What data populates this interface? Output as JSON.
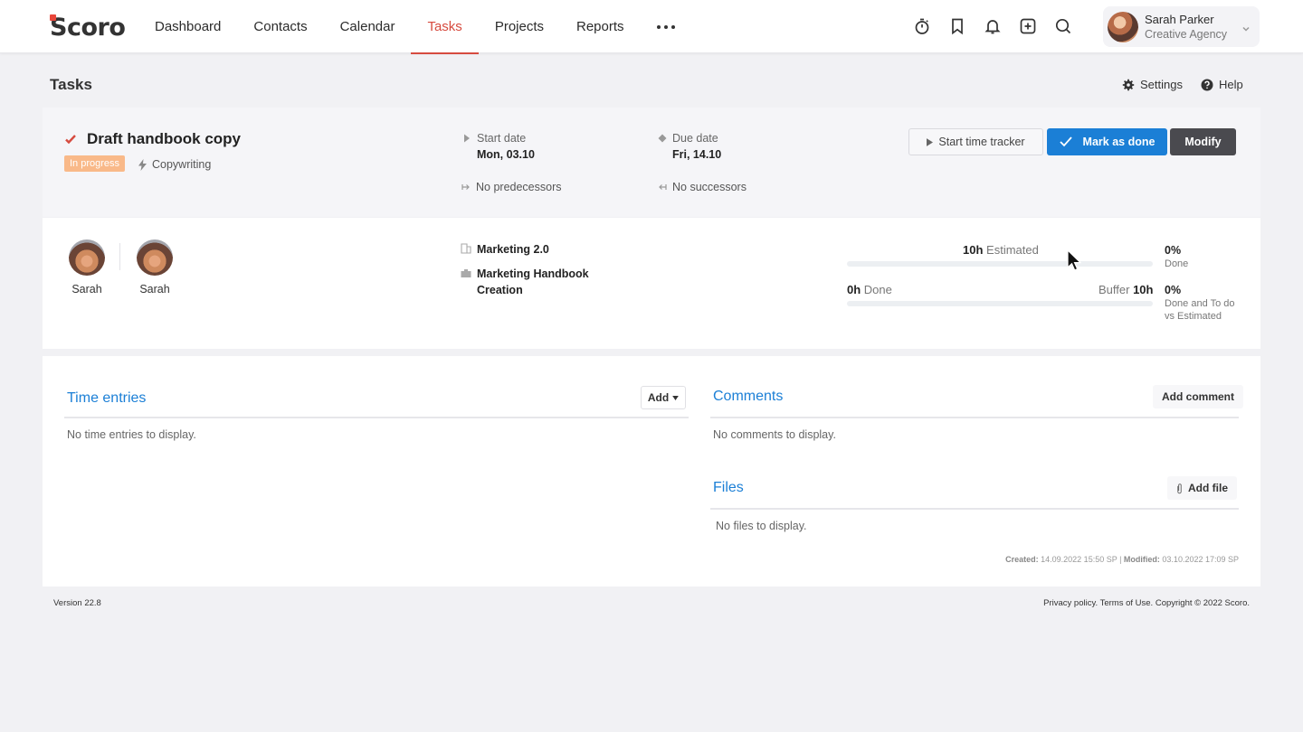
{
  "brand": {
    "logo_text": "Scoro"
  },
  "nav": {
    "items": [
      "Dashboard",
      "Contacts",
      "Calendar",
      "Tasks",
      "Projects",
      "Reports"
    ],
    "active": "Tasks"
  },
  "user": {
    "name": "Sarah Parker",
    "company": "Creative Agency"
  },
  "page": {
    "title": "Tasks",
    "settings_label": "Settings",
    "help_label": "Help"
  },
  "task": {
    "title": "Draft handbook copy",
    "status": "In progress",
    "category": "Copywriting",
    "start_label": "Start date",
    "start_value": "Mon, 03.10",
    "due_label": "Due date",
    "due_value": "Fri, 14.10",
    "predecessors": "No predecessors",
    "successors": "No successors",
    "buttons": {
      "tracker": "Start time tracker",
      "done": "Mark as done",
      "modify": "Modify"
    }
  },
  "assignees": [
    {
      "name": "Sarah"
    },
    {
      "name": "Sarah"
    }
  ],
  "project": {
    "name": "Marketing 2.0",
    "phase": "Marketing Handbook Creation"
  },
  "progress": {
    "estimated_value": "10h",
    "estimated_label": "Estimated",
    "done_value": "0h",
    "done_label": "Done",
    "buffer_label": "Buffer",
    "buffer_value": "10h",
    "done_fraction": 0,
    "done_vs_est_fraction": 0,
    "pct_done": "0%",
    "pct_done_label": "Done",
    "pct_todo": "0%",
    "pct_todo_label": "Done and To do vs Estimated"
  },
  "time_entries": {
    "title": "Time entries",
    "add_label": "Add",
    "empty": "No time entries to display."
  },
  "comments": {
    "title": "Comments",
    "add_label": "Add comment",
    "empty": "No comments to display."
  },
  "files": {
    "title": "Files",
    "add_label": "Add file",
    "empty": "No files to display."
  },
  "audit": {
    "created_label": "Created:",
    "created_value": "14.09.2022 15:50 SP",
    "modified_label": "Modified:",
    "modified_value": "03.10.2022 17:09 SP"
  },
  "footer": {
    "version": "Version 22.8",
    "legal": "Privacy policy. Terms of Use. Copyright © 2022 Scoro."
  },
  "colors": {
    "accent": "#1b7fd6",
    "active_nav": "#d64b3f",
    "status_badge": "#f9b989"
  }
}
